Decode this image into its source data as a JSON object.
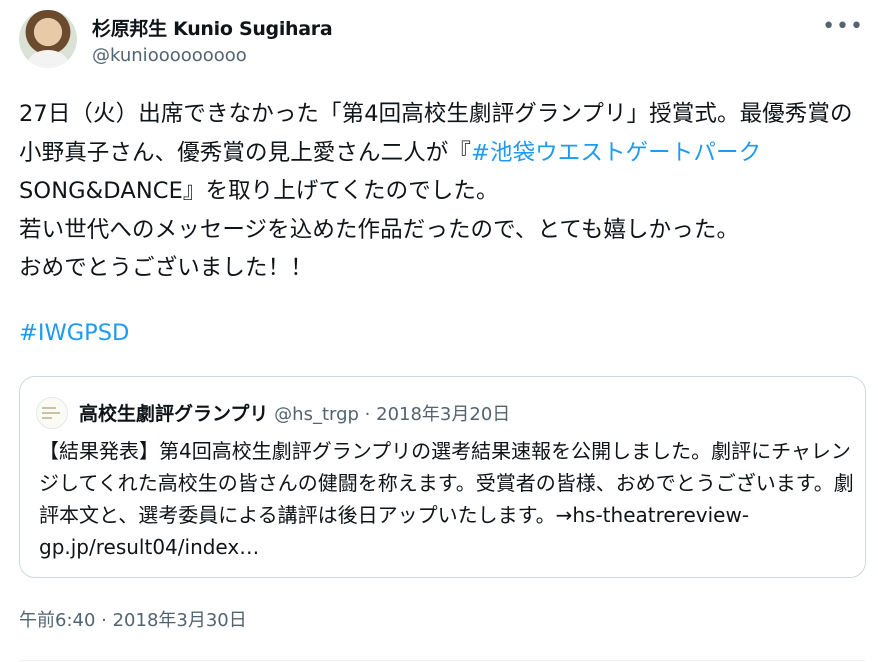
{
  "author": {
    "display_name": "杉原邦生 Kunio Sugihara",
    "handle": "@kuniooooooooo"
  },
  "more_icon": "more-horizontal-icon",
  "tweet": {
    "text_before_link": "27日（火）出席できなかった「第4回高校生劇評グランプリ」授賞式。最優秀賞の小野真子さん、優秀賞の見上愛さん二人が『",
    "link_text": "#池袋ウエストゲートパーク",
    "text_after_link": " SONG&DANCE』を取り上げてくたのでした。\n若い世代へのメッセージを込めた作品だったので、とても嬉しかった。\nおめでとうございました！！",
    "hashtag": "#IWGPSD"
  },
  "quoted": {
    "name": "高校生劇評グランプリ",
    "handle": "@hs_trgp",
    "separator": " · ",
    "date": "2018年3月20日",
    "body": "【結果発表】第4回高校生劇評グランプリの選考結果速報を公開しました。劇評にチャレンジしてくれた高校生の皆さんの健闘を称えます。受賞者の皆様、おめでとうございます。劇評本文と、選考委員による講評は後日アップいたします。→hs-theatrereview-gp.jp/result04/index…"
  },
  "timestamp": "午前6:40 · 2018年3月30日",
  "colors": {
    "link": "#1d9bf0",
    "secondary_text": "#536471",
    "border": "#cfd9de"
  }
}
